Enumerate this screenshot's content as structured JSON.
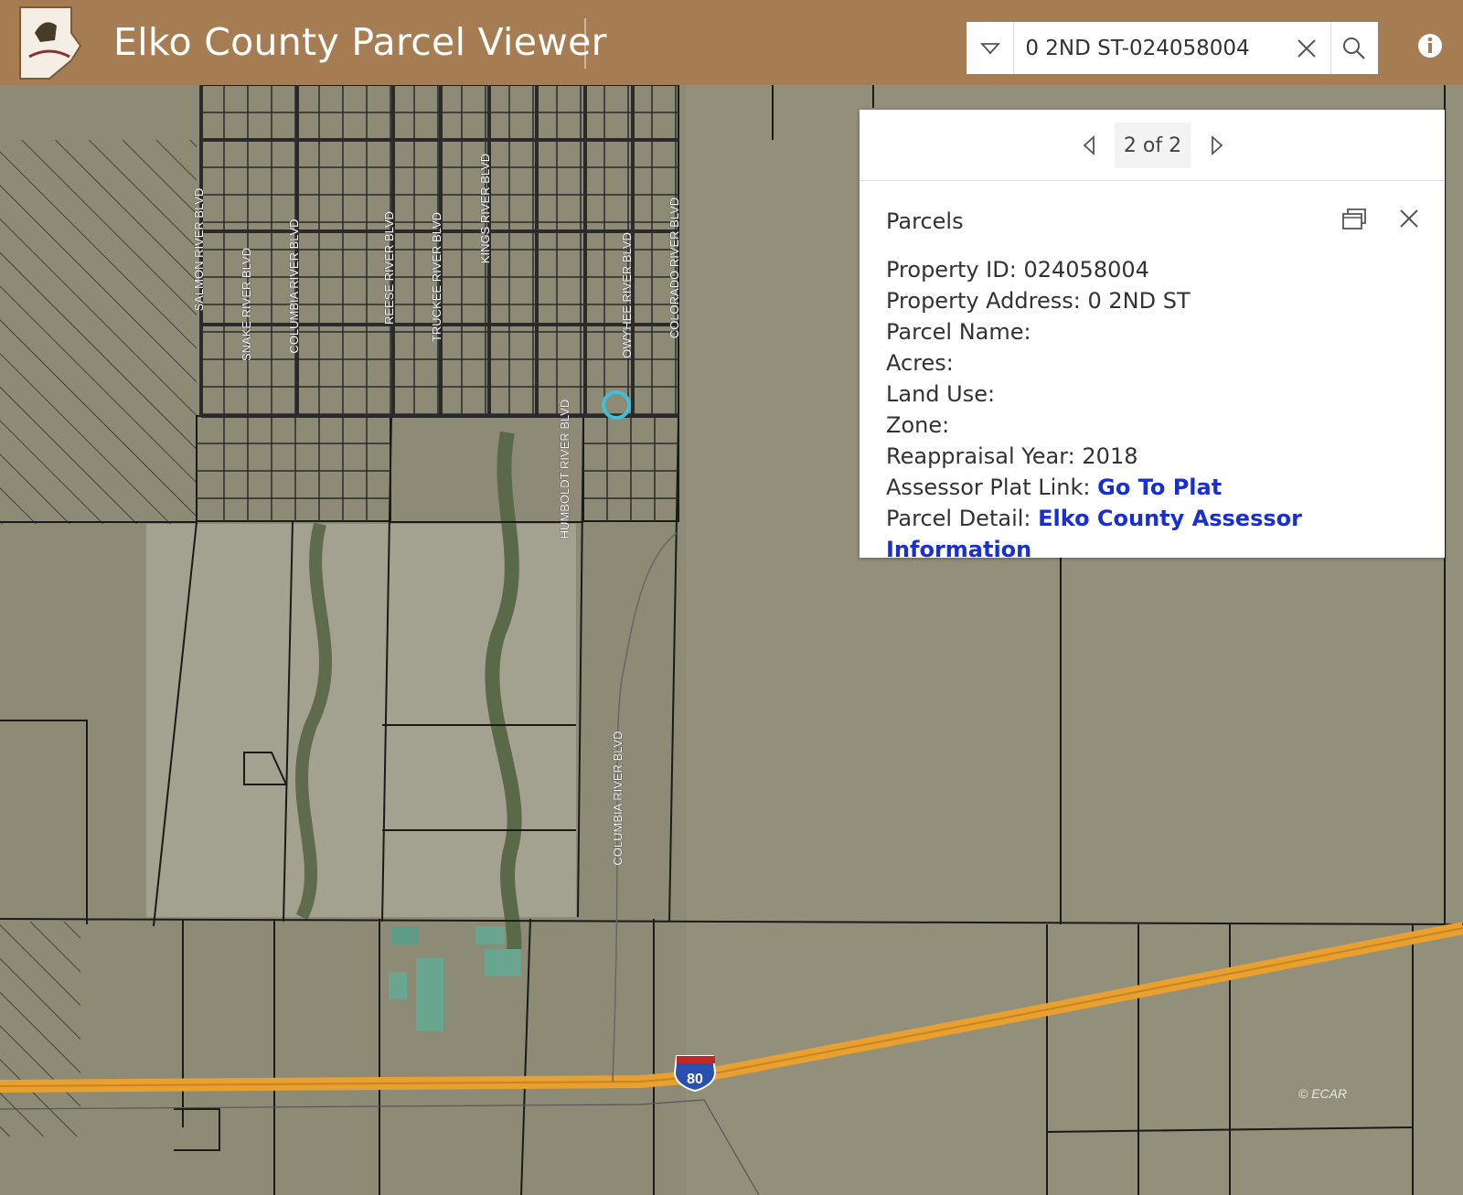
{
  "header": {
    "title": "Elko County Parcel Viewer",
    "logo_text": "Elko County"
  },
  "search": {
    "value": "0 2ND ST-024058004",
    "placeholder": "Find address or place"
  },
  "popup": {
    "pager": "2 of 2",
    "title": "Parcels",
    "fields": [
      {
        "label": "Property ID:",
        "value": "024058004"
      },
      {
        "label": "Property Address:",
        "value": "0 2ND ST"
      },
      {
        "label": "Parcel Name:",
        "value": ""
      },
      {
        "label": "Acres:",
        "value": ""
      },
      {
        "label": "Land Use:",
        "value": ""
      },
      {
        "label": "Zone:",
        "value": ""
      },
      {
        "label": "Reappraisal Year:",
        "value": "2018"
      }
    ],
    "links": [
      {
        "label": "Assessor Plat Link:",
        "text": "Go To Plat"
      },
      {
        "label": "Parcel Detail:",
        "text": "Elko County Assessor Information"
      }
    ]
  },
  "map": {
    "street_labels": [
      "SALMON RIVER BLVD",
      "SNAKE RIVER BLVD",
      "COLUMBIA RIVER BLVD",
      "REESE RIVER BLVD",
      "TRUCKEE RIVER BLVD",
      "KINGS RIVER BLVD",
      "OWYHEE RIVER BLVD",
      "COLORADO RIVER BLVD",
      "HUMBOLDT RIVER BLVD",
      "COLUMBIA RIVER BLVD"
    ],
    "highway_shield": "80",
    "attribution": "© ECAR"
  },
  "colors": {
    "header": "#a67c52",
    "link": "#1a2fcf",
    "highway": "#e8a030",
    "parcel_lines": "#1a1a1a"
  }
}
